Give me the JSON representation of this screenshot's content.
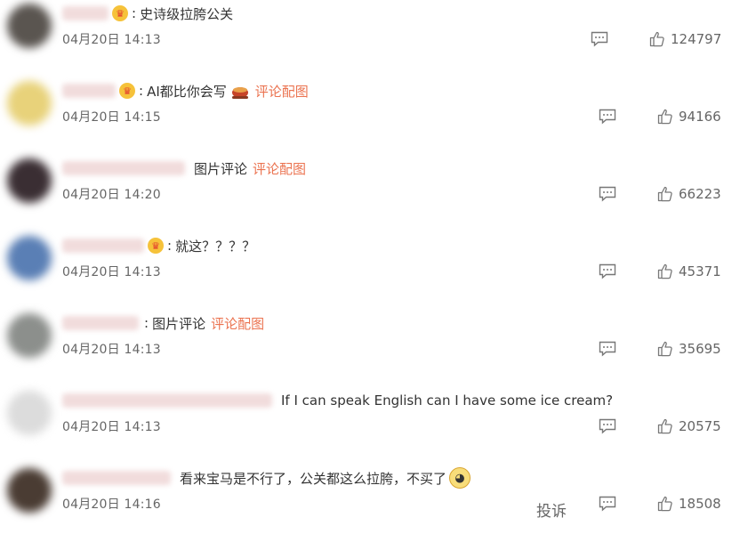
{
  "comments": [
    {
      "text": "史诗级拉胯公关",
      "pic_label": "",
      "time": "04月20日 14:13",
      "likes": "124797"
    },
    {
      "text": "AI都比你会写",
      "pic_label": "评论配图",
      "time": "04月20日 14:15",
      "likes": "94166"
    },
    {
      "text": "图片评论",
      "pic_label": "评论配图",
      "time": "04月20日 14:20",
      "likes": "66223"
    },
    {
      "text": "就这？？？？",
      "pic_label": "",
      "time": "04月20日 14:13",
      "likes": "45371"
    },
    {
      "text": "图片评论",
      "pic_label": "评论配图",
      "time": "04月20日 14:13",
      "likes": "35695"
    },
    {
      "text": "If I can speak English can I have some ice cream?",
      "pic_label": "",
      "time": "04月20日 14:13",
      "likes": "20575"
    },
    {
      "text": "看来宝马是不行了，公关都这么拉胯，不买了",
      "pic_label": "",
      "time": "04月20日 14:16",
      "likes": "18508"
    }
  ],
  "report_label": "投诉",
  "colors": {
    "link": "#eb7350",
    "meta": "#666666",
    "text": "#333333",
    "vip_bg": "#f6c23a"
  },
  "icons": {
    "reply": "comment-bubble-icon",
    "like": "thumbs-up-icon",
    "badge": "vip-crown-badge-icon"
  }
}
